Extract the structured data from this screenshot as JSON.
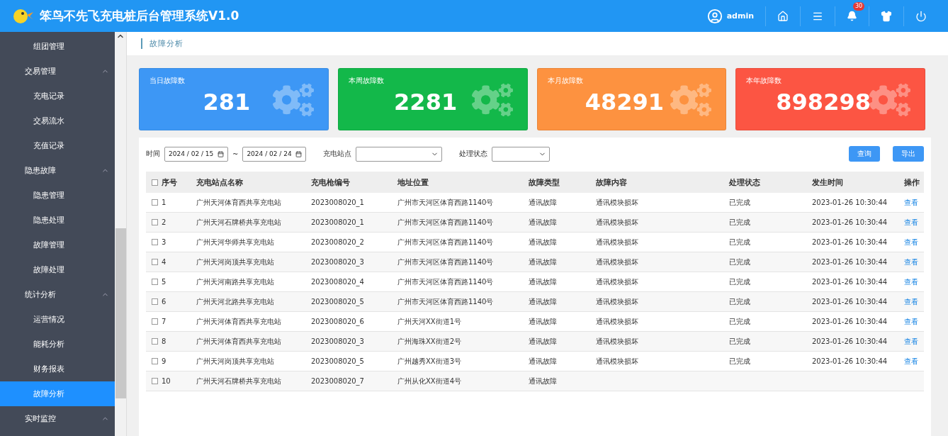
{
  "header": {
    "title": "笨鸟不先飞充电桩后台管理系统V1.0",
    "user": "admin",
    "notification_count": "30"
  },
  "sidebar": {
    "leading_items": [
      {
        "label": "组团管理",
        "selected": false
      }
    ],
    "groups": [
      {
        "label": "交易管理",
        "expanded": true,
        "children": [
          {
            "label": "充电记录",
            "selected": false
          },
          {
            "label": "交易流水",
            "selected": false
          },
          {
            "label": "充值记录",
            "selected": false
          }
        ]
      },
      {
        "label": "隐患故障",
        "expanded": true,
        "children": [
          {
            "label": "隐患管理",
            "selected": false
          },
          {
            "label": "隐患处理",
            "selected": false
          },
          {
            "label": "故障管理",
            "selected": false
          },
          {
            "label": "故障处理",
            "selected": false
          }
        ]
      },
      {
        "label": "统计分析",
        "expanded": true,
        "children": [
          {
            "label": "运营情况",
            "selected": false
          },
          {
            "label": "能耗分析",
            "selected": false
          },
          {
            "label": "财务报表",
            "selected": false
          },
          {
            "label": "故障分析",
            "selected": true
          }
        ]
      },
      {
        "label": "实时监控",
        "expanded": true
      }
    ]
  },
  "breadcrumb": "故障分析",
  "stats": [
    {
      "label": "当日故障数",
      "value": "281",
      "color": "#3d97f5"
    },
    {
      "label": "本周故障数",
      "value": "2281",
      "color": "#13b84a"
    },
    {
      "label": "本月故障数",
      "value": "48291",
      "color": "#fd9240"
    },
    {
      "label": "本年故障数",
      "value": "898298",
      "color": "#fc5543"
    }
  ],
  "filters": {
    "time_label": "时间",
    "date_from": "2024 / 02 / 15",
    "separator": "~",
    "date_to": "2024 / 02 / 24",
    "station_label": "充电站点",
    "status_label": "处理状态",
    "buttons": [
      "查询",
      "导出"
    ]
  },
  "table": {
    "all_checked": false,
    "columns": [
      "序号",
      "充电站点名称",
      "充电枪编号",
      "地址位置",
      "故障类型",
      "故障内容",
      "处理状态",
      "发生时间",
      "操作"
    ],
    "rows": [
      {
        "checked": false,
        "cells": [
          "1",
          "广州天河体育西共享充电站",
          "2023008020_1",
          "广州市天河区体育西路1140号",
          "通讯故障",
          "通讯模块损坏",
          "已完成",
          "2023-01-26 10:30:44",
          "查看"
        ]
      },
      {
        "checked": false,
        "cells": [
          "2",
          "广州天河石牌桥共享充电站",
          "2023008020_1",
          "广州市天河区体育西路1140号",
          "通讯故障",
          "通讯模块损坏",
          "已完成",
          "2023-01-26 10:30:44",
          "查看"
        ]
      },
      {
        "checked": false,
        "cells": [
          "3",
          "广州天河华师共享充电站",
          "2023008020_2",
          "广州市天河区体育西路1140号",
          "通讯故障",
          "通讯模块损坏",
          "已完成",
          "2023-01-26 10:30:44",
          "查看"
        ]
      },
      {
        "checked": false,
        "cells": [
          "4",
          "广州天河岗顶共享充电站",
          "2023008020_3",
          "广州市天河区体育西路1140号",
          "通讯故障",
          "通讯模块损坏",
          "已完成",
          "2023-01-26 10:30:44",
          "查看"
        ]
      },
      {
        "checked": false,
        "cells": [
          "5",
          "广州天河南路共享充电站",
          "2023008020_4",
          "广州市天河区体育西路1140号",
          "通讯故障",
          "通讯模块损坏",
          "已完成",
          "2023-01-26 10:30:44",
          "查看"
        ]
      },
      {
        "checked": false,
        "cells": [
          "6",
          "广州天河北路共享充电站",
          "2023008020_5",
          "广州市天河区体育西路1140号",
          "通讯故障",
          "通讯模块损坏",
          "已完成",
          "2023-01-26 10:30:44",
          "查看"
        ]
      },
      {
        "checked": false,
        "cells": [
          "7",
          "广州天河体育西共享充电站",
          "2023008020_6",
          "广州天河XX街道1号",
          "通讯故障",
          "通讯模块损坏",
          "已完成",
          "2023-01-26 10:30:44",
          "查看"
        ]
      },
      {
        "checked": false,
        "cells": [
          "8",
          "广州天河体育西共享充电站",
          "2023008020_3",
          "广州海珠XX街道2号",
          "通讯故障",
          "通讯模块损坏",
          "已完成",
          "2023-01-26 10:30:44",
          "查看"
        ]
      },
      {
        "checked": false,
        "cells": [
          "9",
          "广州天河岗顶共享充电站",
          "2023008020_5",
          "广州越秀XX街道3号",
          "通讯故障",
          "通讯模块损坏",
          "已完成",
          "2023-01-26 10:30:44",
          "查看"
        ]
      },
      {
        "checked": false,
        "cells": [
          "10",
          "广州天河石牌桥共享充电站",
          "2023008020_7",
          "广州从化XX街道4号",
          "通讯故障"
        ]
      }
    ]
  }
}
